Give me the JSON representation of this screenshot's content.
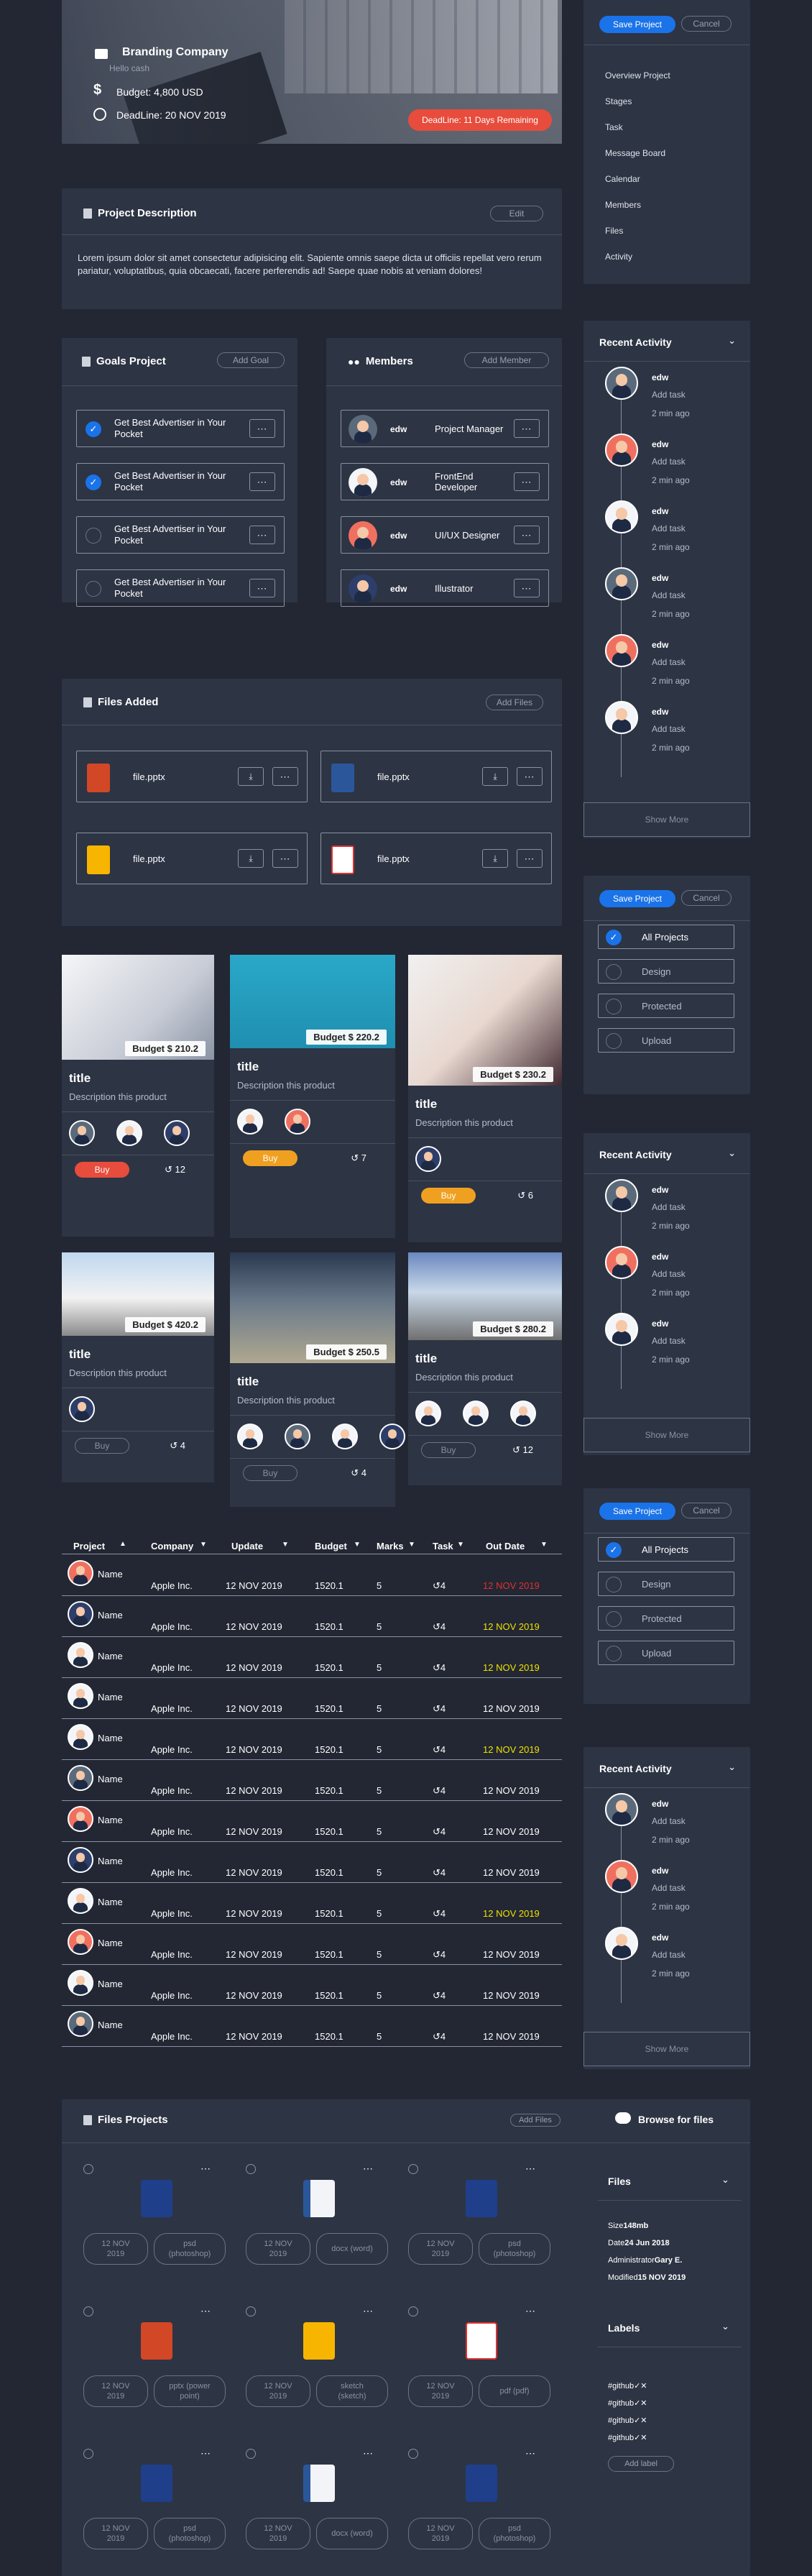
{
  "colors": {
    "bg": "#222733",
    "card": "#2d3444",
    "accent": "#1a73e8",
    "danger": "#e74c3c",
    "warning": "#f0a020",
    "yellow": "#f0e000",
    "red_text": "#e03030"
  },
  "hero": {
    "title": "Branding Company",
    "subtitle": "Hello cash",
    "budget": "Budget: 4,800 USD",
    "deadline": "DeadLine: 20 NOV 2019",
    "remaining": "DeadLine: 11 Days Remaining"
  },
  "side_menu": {
    "save": "Save Project",
    "cancel": "Cancel",
    "items": [
      "Overview Project",
      "Stages",
      "Task",
      "Message Board",
      "Calendar",
      "Members",
      "Files",
      "Activity"
    ]
  },
  "description": {
    "title": "Project Description",
    "edit": "Edit",
    "text": "Lorem ipsum dolor sit amet consectetur adipisicing elit. Sapiente omnis saepe dicta ut officiis repellat vero rerum pariatur, voluptatibus, quia obcaecati, facere perferendis ad! Saepe quae nobis at veniam dolores!"
  },
  "goals": {
    "title": "Goals Project",
    "add": "Add Goal",
    "items": [
      {
        "text": "Get Best Advertiser in Your Pocket",
        "done": true
      },
      {
        "text": "Get Best Advertiser in Your Pocket",
        "done": true
      },
      {
        "text": "Get Best Advertiser in Your Pocket",
        "done": false
      },
      {
        "text": "Get Best Advertiser in Your Pocket",
        "done": false
      }
    ]
  },
  "members": {
    "title": "Members",
    "add": "Add Member",
    "items": [
      {
        "name": "edw",
        "role": "Project Manager"
      },
      {
        "name": "edw",
        "role": "FrontEnd Developer"
      },
      {
        "name": "edw",
        "role": "UI/UX Designer"
      },
      {
        "name": "edw",
        "role": "Illustrator"
      }
    ]
  },
  "files": {
    "title": "Files Added",
    "add": "Add Files",
    "items": [
      {
        "name": "file.pptx",
        "icon": "pptx-icon"
      },
      {
        "name": "file.pptx",
        "icon": "word-icon"
      },
      {
        "name": "file.pptx",
        "icon": "sketch-icon"
      },
      {
        "name": "file.pptx",
        "icon": "pdf-icon"
      }
    ]
  },
  "products": [
    {
      "budget": "Budget $ 210.2",
      "title": "title",
      "desc": "Description this product",
      "buy": "Buy",
      "tasks": "12"
    },
    {
      "budget": "Budget $ 220.2",
      "title": "title",
      "desc": "Description this product",
      "buy": "Buy",
      "tasks": "7"
    },
    {
      "budget": "Budget $ 230.2",
      "title": "title",
      "desc": "Description this product",
      "buy": "Buy",
      "tasks": "6"
    },
    {
      "budget": "Budget $ 420.2",
      "title": "title",
      "desc": "Description this product",
      "buy": "Buy",
      "tasks": "4"
    },
    {
      "budget": "Budget $ 250.5",
      "title": "title",
      "desc": "Description this product",
      "buy": "Buy",
      "tasks": "4"
    },
    {
      "budget": "Budget $ 280.2",
      "title": "title",
      "desc": "Description this product",
      "buy": "Buy",
      "tasks": "12"
    }
  ],
  "activity": {
    "title": "Recent Activity",
    "show_more": "Show More",
    "items": [
      {
        "name": "edw",
        "what": "Add task",
        "time": "2 min ago"
      },
      {
        "name": "edw",
        "what": "Add task",
        "time": "2 min ago"
      },
      {
        "name": "edw",
        "what": "Add task",
        "time": "2 min ago"
      },
      {
        "name": "edw",
        "what": "Add task",
        "time": "2 min ago"
      },
      {
        "name": "edw",
        "what": "Add task",
        "time": "2 min ago"
      },
      {
        "name": "edw",
        "what": "Add task",
        "time": "2 min ago"
      }
    ]
  },
  "filter": {
    "save": "Save Project",
    "cancel": "Cancel",
    "items": [
      "All Projects",
      "Design",
      "Protected",
      "Upload"
    ]
  },
  "table": {
    "headers": [
      "Project",
      "Company",
      "Update",
      "Budget",
      "Marks",
      "Task",
      "Out Date"
    ],
    "rows": [
      {
        "name": "Name",
        "company": "Apple Inc.",
        "update": "12 NOV 2019",
        "budget": "1520.1",
        "marks": "5",
        "task": "4",
        "out": "12 NOV 2019",
        "out_color": "red"
      },
      {
        "name": "Name",
        "company": "Apple Inc.",
        "update": "12 NOV 2019",
        "budget": "1520.1",
        "marks": "5",
        "task": "4",
        "out": "12 NOV 2019",
        "out_color": "yellow"
      },
      {
        "name": "Name",
        "company": "Apple Inc.",
        "update": "12 NOV 2019",
        "budget": "1520.1",
        "marks": "5",
        "task": "4",
        "out": "12 NOV 2019",
        "out_color": "yellow"
      },
      {
        "name": "Name",
        "company": "Apple Inc.",
        "update": "12 NOV 2019",
        "budget": "1520.1",
        "marks": "5",
        "task": "4",
        "out": "12 NOV 2019",
        "out_color": "white"
      },
      {
        "name": "Name",
        "company": "Apple Inc.",
        "update": "12 NOV 2019",
        "budget": "1520.1",
        "marks": "5",
        "task": "4",
        "out": "12 NOV 2019",
        "out_color": "yellow"
      },
      {
        "name": "Name",
        "company": "Apple Inc.",
        "update": "12 NOV 2019",
        "budget": "1520.1",
        "marks": "5",
        "task": "4",
        "out": "12 NOV 2019",
        "out_color": "white"
      },
      {
        "name": "Name",
        "company": "Apple Inc.",
        "update": "12 NOV 2019",
        "budget": "1520.1",
        "marks": "5",
        "task": "4",
        "out": "12 NOV 2019",
        "out_color": "white"
      },
      {
        "name": "Name",
        "company": "Apple Inc.",
        "update": "12 NOV 2019",
        "budget": "1520.1",
        "marks": "5",
        "task": "4",
        "out": "12 NOV 2019",
        "out_color": "white"
      },
      {
        "name": "Name",
        "company": "Apple Inc.",
        "update": "12 NOV 2019",
        "budget": "1520.1",
        "marks": "5",
        "task": "4",
        "out": "12 NOV 2019",
        "out_color": "yellow"
      },
      {
        "name": "Name",
        "company": "Apple Inc.",
        "update": "12 NOV 2019",
        "budget": "1520.1",
        "marks": "5",
        "task": "4",
        "out": "12 NOV 2019",
        "out_color": "white"
      },
      {
        "name": "Name",
        "company": "Apple Inc.",
        "update": "12 NOV 2019",
        "budget": "1520.1",
        "marks": "5",
        "task": "4",
        "out": "12 NOV 2019",
        "out_color": "white"
      },
      {
        "name": "Name",
        "company": "Apple Inc.",
        "update": "12 NOV 2019",
        "budget": "1520.1",
        "marks": "5",
        "task": "4",
        "out": "12 NOV 2019",
        "out_color": "white"
      }
    ]
  },
  "files_projects": {
    "title": "Files Projects",
    "add": "Add Files",
    "browse": "Browse for files",
    "items": [
      {
        "icon": "photoshop-icon",
        "date": "12 NOV 2019",
        "type": "psd (photoshop)"
      },
      {
        "icon": "word-icon",
        "date": "12 NOV 2019",
        "type": "docx (word)"
      },
      {
        "icon": "photoshop-icon",
        "date": "12 NOV 2019",
        "type": "psd (photoshop)"
      },
      {
        "icon": "pptx-icon",
        "date": "12 NOV 2019",
        "type": "pptx (power point)"
      },
      {
        "icon": "sketch-icon",
        "date": "12 NOV 2019",
        "type": "sketch (sketch)"
      },
      {
        "icon": "pdf-icon",
        "date": "12 NOV 2019",
        "type": "pdf (pdf)"
      },
      {
        "icon": "photoshop-icon",
        "date": "12 NOV 2019",
        "type": "psd (photoshop)"
      },
      {
        "icon": "word-icon",
        "date": "12 NOV 2019",
        "type": "docx (word)"
      },
      {
        "icon": "photoshop-icon",
        "date": "12 NOV 2019",
        "type": "psd (photoshop)"
      }
    ]
  },
  "file_info": {
    "title": "Files",
    "size_label": "Size",
    "size": "148mb",
    "date_label": "Date",
    "date": "24 Jun 2018",
    "admin_label": "Administrator",
    "admin": "Gary E.",
    "mod_label": "Modified",
    "mod": "15 NOV 2019"
  },
  "labels": {
    "title": "Labels",
    "items": [
      "#github",
      "#github",
      "#github",
      "#github"
    ],
    "add": "Add label"
  }
}
